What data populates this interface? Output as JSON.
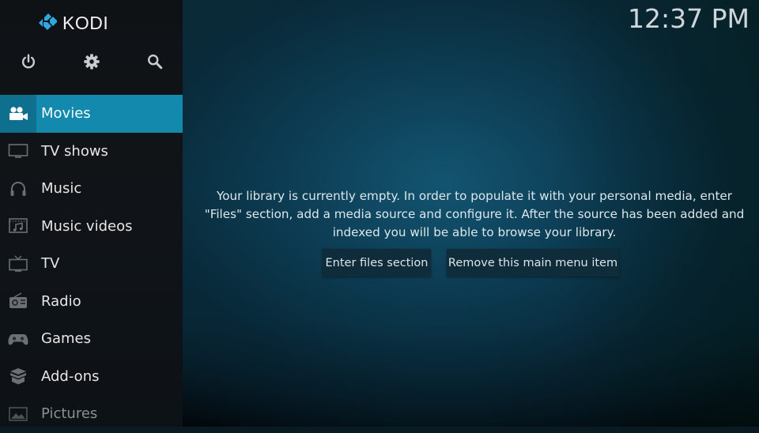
{
  "app": {
    "logo_text": "KODI",
    "clock": "12:37 PM"
  },
  "top_icons": [
    {
      "name": "power-icon",
      "label": "Power"
    },
    {
      "name": "settings-gear-icon",
      "label": "Settings"
    },
    {
      "name": "search-icon",
      "label": "Search"
    }
  ],
  "menu": {
    "items": [
      {
        "label": "Movies",
        "icon": "movie-camera-icon",
        "active": true
      },
      {
        "label": "TV shows",
        "icon": "tv-monitor-icon",
        "active": false
      },
      {
        "label": "Music",
        "icon": "headphones-icon",
        "active": false
      },
      {
        "label": "Music videos",
        "icon": "music-video-icon",
        "active": false
      },
      {
        "label": "TV",
        "icon": "tv-antenna-icon",
        "active": false
      },
      {
        "label": "Radio",
        "icon": "radio-icon",
        "active": false
      },
      {
        "label": "Games",
        "icon": "gamepad-icon",
        "active": false
      },
      {
        "label": "Add-ons",
        "icon": "addon-box-icon",
        "active": false
      },
      {
        "label": "Pictures",
        "icon": "pictures-icon",
        "active": false
      }
    ]
  },
  "main": {
    "message_lines": [
      "Your library is currently empty. In order to populate it with your personal media, enter",
      "\"Files\" section, add a media source and configure it. After the source has been added and",
      "indexed you will be able to browse your library."
    ],
    "buttons": {
      "enter_files": "Enter files section",
      "remove_item": "Remove this main menu item"
    }
  },
  "colors": {
    "accent": "#138aad",
    "accent_dark": "#0f6f8e",
    "logo_blue": "#2fa8dd",
    "sidebar_bg": "#101418",
    "button_bg": "#0f2c3a"
  }
}
